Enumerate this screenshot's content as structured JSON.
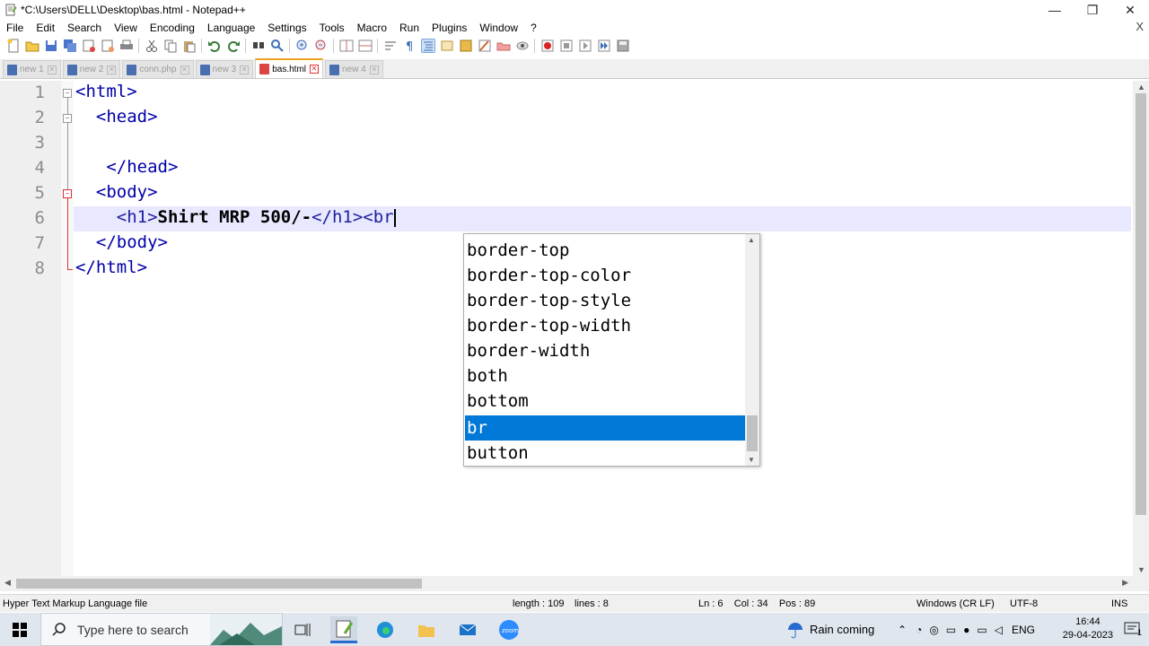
{
  "window": {
    "title": "*C:\\Users\\DELL\\Desktop\\bas.html - Notepad++",
    "minimize": "—",
    "restore": "❐",
    "close": "✕"
  },
  "menu": {
    "items": [
      "File",
      "Edit",
      "Search",
      "View",
      "Encoding",
      "Language",
      "Settings",
      "Tools",
      "Macro",
      "Run",
      "Plugins",
      "Window",
      "?"
    ],
    "close_doc": "X"
  },
  "tabs": [
    {
      "label": "new 1",
      "active": false
    },
    {
      "label": "new 2",
      "active": false
    },
    {
      "label": "conn.php",
      "active": false
    },
    {
      "label": "new 3",
      "active": false
    },
    {
      "label": "bas.html",
      "active": true
    },
    {
      "label": "new 4",
      "active": false
    }
  ],
  "editor": {
    "lines": [
      {
        "num": "1",
        "code": "<html>"
      },
      {
        "num": "2",
        "code": "  <head>"
      },
      {
        "num": "3",
        "code": ""
      },
      {
        "num": "4",
        "code": "   </head>"
      },
      {
        "num": "5",
        "code": "  <body>"
      },
      {
        "num": "6",
        "code_open": "    <h1>",
        "code_text": "Shirt MRP 500/-",
        "code_close": "</h1><br"
      },
      {
        "num": "7",
        "code": "  </body>"
      },
      {
        "num": "8",
        "code": "</html>"
      }
    ],
    "current_line": 6
  },
  "autocomplete": {
    "items": [
      "border-top",
      "border-top-color",
      "border-top-style",
      "border-top-width",
      "border-width",
      "both",
      "bottom",
      "br",
      "button"
    ],
    "selected": "br"
  },
  "statusbar": {
    "filetype": "Hyper Text Markup Language file",
    "length": "length : 109",
    "lines": "lines : 8",
    "position": "Ln : 6    Col : 34    Pos : 89",
    "eol": "Windows (CR LF)",
    "encoding": "UTF-8",
    "mode": "INS"
  },
  "taskbar": {
    "search_placeholder": "Type here to search",
    "weather": "Rain coming",
    "language": "ENG",
    "time": "16:44",
    "date": "29-04-2023",
    "notification_count": "1"
  },
  "colors": {
    "selection": "#0078d7",
    "current_line": "#e8e8ff",
    "tag": "#2020a0",
    "active_tab_accent": "#f0a020"
  }
}
